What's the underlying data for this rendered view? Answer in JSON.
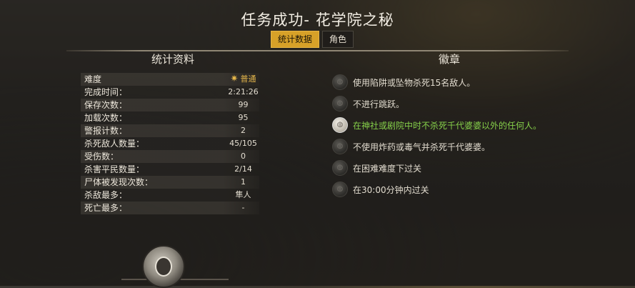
{
  "title": "任务成功- 花学院之秘",
  "tabs": [
    "统计数据",
    "角色"
  ],
  "left_title": "统计资料",
  "right_title": "徽章",
  "stats": [
    {
      "k": "难度",
      "v": "普通"
    },
    {
      "k": "完成时间：",
      "v": "2:21:26"
    },
    {
      "k": "保存次数：",
      "v": "99"
    },
    {
      "k": "加载次数：",
      "v": "95"
    },
    {
      "k": "警报计数：",
      "v": "2"
    },
    {
      "k": "杀死敌人数量：",
      "v": "45/105"
    },
    {
      "k": "受伤数：",
      "v": "0"
    },
    {
      "k": "杀害平民数量：",
      "v": "2/14"
    },
    {
      "k": "尸体被发现次数：",
      "v": "1"
    },
    {
      "k": "杀敌最多：",
      "v": "隼人"
    },
    {
      "k": "死亡最多：",
      "v": "-"
    }
  ],
  "badges": [
    {
      "text": "使用陷阱或坠物杀死15名敌人。",
      "earned": false
    },
    {
      "text": "不进行跳跃。",
      "earned": false
    },
    {
      "text": "在神社或剧院中时不杀死千代婆婆以外的任何人。",
      "earned": true
    },
    {
      "text": "不使用炸药或毒气并杀死千代婆婆。",
      "earned": false
    },
    {
      "text": "在困难难度下过关",
      "earned": false
    },
    {
      "text": "在30:00分钟内过关",
      "earned": false
    }
  ]
}
